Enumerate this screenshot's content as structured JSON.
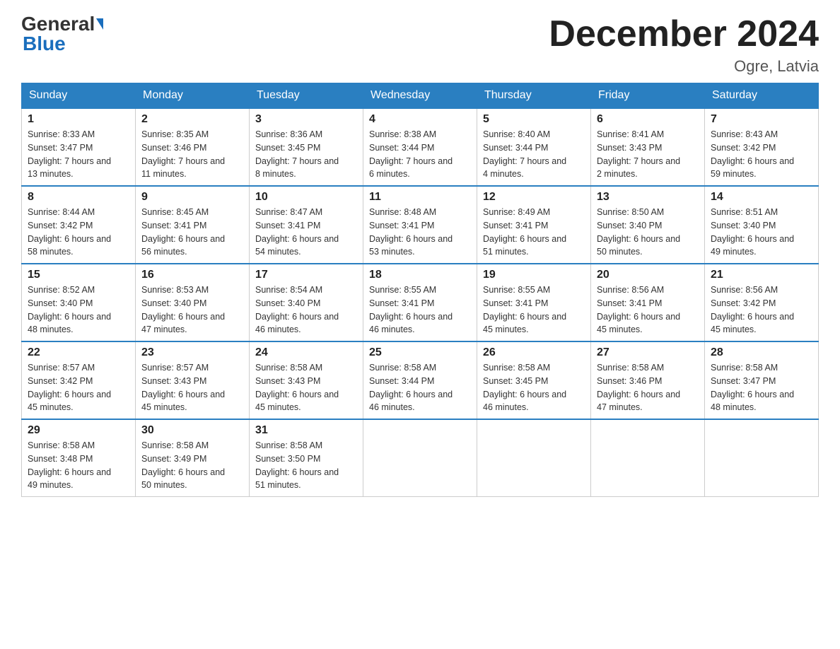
{
  "header": {
    "logo_general": "General",
    "logo_blue": "Blue",
    "month_title": "December 2024",
    "location": "Ogre, Latvia"
  },
  "days_of_week": [
    "Sunday",
    "Monday",
    "Tuesday",
    "Wednesday",
    "Thursday",
    "Friday",
    "Saturday"
  ],
  "weeks": [
    [
      {
        "day": "1",
        "sunrise": "8:33 AM",
        "sunset": "3:47 PM",
        "daylight": "7 hours and 13 minutes."
      },
      {
        "day": "2",
        "sunrise": "8:35 AM",
        "sunset": "3:46 PM",
        "daylight": "7 hours and 11 minutes."
      },
      {
        "day": "3",
        "sunrise": "8:36 AM",
        "sunset": "3:45 PM",
        "daylight": "7 hours and 8 minutes."
      },
      {
        "day": "4",
        "sunrise": "8:38 AM",
        "sunset": "3:44 PM",
        "daylight": "7 hours and 6 minutes."
      },
      {
        "day": "5",
        "sunrise": "8:40 AM",
        "sunset": "3:44 PM",
        "daylight": "7 hours and 4 minutes."
      },
      {
        "day": "6",
        "sunrise": "8:41 AM",
        "sunset": "3:43 PM",
        "daylight": "7 hours and 2 minutes."
      },
      {
        "day": "7",
        "sunrise": "8:43 AM",
        "sunset": "3:42 PM",
        "daylight": "6 hours and 59 minutes."
      }
    ],
    [
      {
        "day": "8",
        "sunrise": "8:44 AM",
        "sunset": "3:42 PM",
        "daylight": "6 hours and 58 minutes."
      },
      {
        "day": "9",
        "sunrise": "8:45 AM",
        "sunset": "3:41 PM",
        "daylight": "6 hours and 56 minutes."
      },
      {
        "day": "10",
        "sunrise": "8:47 AM",
        "sunset": "3:41 PM",
        "daylight": "6 hours and 54 minutes."
      },
      {
        "day": "11",
        "sunrise": "8:48 AM",
        "sunset": "3:41 PM",
        "daylight": "6 hours and 53 minutes."
      },
      {
        "day": "12",
        "sunrise": "8:49 AM",
        "sunset": "3:41 PM",
        "daylight": "6 hours and 51 minutes."
      },
      {
        "day": "13",
        "sunrise": "8:50 AM",
        "sunset": "3:40 PM",
        "daylight": "6 hours and 50 minutes."
      },
      {
        "day": "14",
        "sunrise": "8:51 AM",
        "sunset": "3:40 PM",
        "daylight": "6 hours and 49 minutes."
      }
    ],
    [
      {
        "day": "15",
        "sunrise": "8:52 AM",
        "sunset": "3:40 PM",
        "daylight": "6 hours and 48 minutes."
      },
      {
        "day": "16",
        "sunrise": "8:53 AM",
        "sunset": "3:40 PM",
        "daylight": "6 hours and 47 minutes."
      },
      {
        "day": "17",
        "sunrise": "8:54 AM",
        "sunset": "3:40 PM",
        "daylight": "6 hours and 46 minutes."
      },
      {
        "day": "18",
        "sunrise": "8:55 AM",
        "sunset": "3:41 PM",
        "daylight": "6 hours and 46 minutes."
      },
      {
        "day": "19",
        "sunrise": "8:55 AM",
        "sunset": "3:41 PM",
        "daylight": "6 hours and 45 minutes."
      },
      {
        "day": "20",
        "sunrise": "8:56 AM",
        "sunset": "3:41 PM",
        "daylight": "6 hours and 45 minutes."
      },
      {
        "day": "21",
        "sunrise": "8:56 AM",
        "sunset": "3:42 PM",
        "daylight": "6 hours and 45 minutes."
      }
    ],
    [
      {
        "day": "22",
        "sunrise": "8:57 AM",
        "sunset": "3:42 PM",
        "daylight": "6 hours and 45 minutes."
      },
      {
        "day": "23",
        "sunrise": "8:57 AM",
        "sunset": "3:43 PM",
        "daylight": "6 hours and 45 minutes."
      },
      {
        "day": "24",
        "sunrise": "8:58 AM",
        "sunset": "3:43 PM",
        "daylight": "6 hours and 45 minutes."
      },
      {
        "day": "25",
        "sunrise": "8:58 AM",
        "sunset": "3:44 PM",
        "daylight": "6 hours and 46 minutes."
      },
      {
        "day": "26",
        "sunrise": "8:58 AM",
        "sunset": "3:45 PM",
        "daylight": "6 hours and 46 minutes."
      },
      {
        "day": "27",
        "sunrise": "8:58 AM",
        "sunset": "3:46 PM",
        "daylight": "6 hours and 47 minutes."
      },
      {
        "day": "28",
        "sunrise": "8:58 AM",
        "sunset": "3:47 PM",
        "daylight": "6 hours and 48 minutes."
      }
    ],
    [
      {
        "day": "29",
        "sunrise": "8:58 AM",
        "sunset": "3:48 PM",
        "daylight": "6 hours and 49 minutes."
      },
      {
        "day": "30",
        "sunrise": "8:58 AM",
        "sunset": "3:49 PM",
        "daylight": "6 hours and 50 minutes."
      },
      {
        "day": "31",
        "sunrise": "8:58 AM",
        "sunset": "3:50 PM",
        "daylight": "6 hours and 51 minutes."
      },
      null,
      null,
      null,
      null
    ]
  ],
  "labels": {
    "sunrise": "Sunrise:",
    "sunset": "Sunset:",
    "daylight": "Daylight:"
  }
}
